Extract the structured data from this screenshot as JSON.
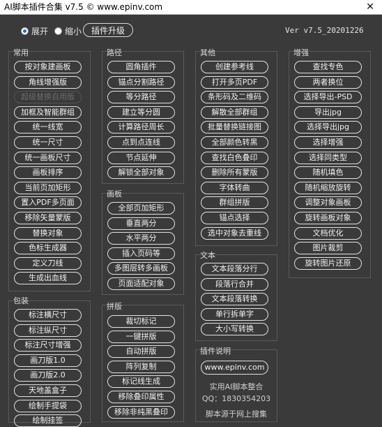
{
  "window": {
    "title": "AI脚本插件合集 v7.5 © www.epinv.com",
    "close_glyph": "✕"
  },
  "toolbar": {
    "expand_label": "展开",
    "collapse_label": "缩小",
    "selected_mode": "展开",
    "upgrade_label": "插件升级",
    "version": "Ver v7.5_20201226"
  },
  "groups": {
    "common": {
      "title": "常用",
      "items": [
        "按对象建画板",
        "角线增强版",
        "超级替换自用版",
        "加框及智能群组",
        "统一线宽",
        "统一尺寸",
        "统一画板尺寸",
        "画板排序",
        "当前页加矩形",
        "置入PDF多页面",
        "移除矢量蒙版",
        "替换对象",
        "色标生成器",
        "定义刀线",
        "生成出血线"
      ],
      "disabled_item": "超级替换自用版"
    },
    "package": {
      "title": "包装",
      "items": [
        "标注横尺寸",
        "标注纵尺寸",
        "标注尺寸增强",
        "画刀版1.0",
        "画刀版2.0",
        "天地盖盒子",
        "绘制手提袋",
        "绘制挂签"
      ]
    },
    "path": {
      "title": "路径",
      "items": [
        "圆角插件",
        "锚点分割路径",
        "等分路径",
        "建立等分圆",
        "计算路径周长",
        "点到点连线",
        "节点延伸",
        "解锁全部对象"
      ]
    },
    "artboard": {
      "title": "画板",
      "items": [
        "全部页加矩形",
        "垂直两分",
        "水平两分",
        "插入页码等",
        "多图层转多画板",
        "页面适配对象"
      ]
    },
    "imposition": {
      "title": "拼版",
      "items": [
        "裁切标记",
        "一键拼版",
        "自动拼版",
        "阵列复制",
        "标记线生成",
        "移除叠印属性",
        "移除非纯黑叠印"
      ]
    },
    "other": {
      "title": "其他",
      "items": [
        "创建参考线",
        "打开多页PDF",
        "条形码及二维码",
        "解散全部群组",
        "批量替换链接图",
        "全部颜色转黑",
        "查找白色叠印",
        "删除所有蒙版",
        "字体转曲",
        "群组拼版",
        "锚点选择",
        "选中对象去重线"
      ]
    },
    "text": {
      "title": "文本",
      "items": [
        "文本段落分行",
        "段落行合并",
        "文本段落转换",
        "单行拆单字",
        "大小写转换"
      ]
    },
    "plugin_info": {
      "title": "插件说明",
      "site": "www.epinv.com",
      "line1": "实用AI脚本整合",
      "line2": "QQ：1830354203",
      "line3": "脚本源于网上搜集"
    },
    "enhance": {
      "title": "增强",
      "items": [
        "查找专色",
        "两者换位",
        "选择导出-PSD",
        "导出jpg",
        "选择导出jpg",
        "选择增强",
        "选择同类型",
        "随机填色",
        "随机缩放旋转",
        "调整对象画板",
        "旋转画板对象",
        "文档优化",
        "图片裁剪",
        "旋转图片还原"
      ]
    }
  }
}
